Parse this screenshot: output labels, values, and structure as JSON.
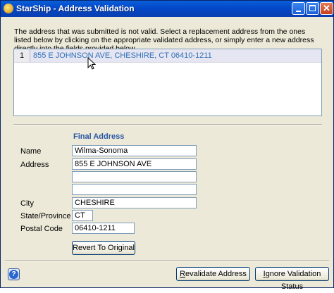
{
  "window": {
    "title": "StarShip - Address Validation",
    "close_glyph": "✕",
    "icons": {
      "app": "app-icon",
      "minimize": "minimize-icon",
      "maximize": "maximize-icon",
      "close": "close-icon"
    }
  },
  "instructions": "The address that was submitted is not valid.  Select a replacement address from the ones listed below by clicking on the appropriate validated address, or simply enter a new address directly into the fields provided below.",
  "suggestions": [
    {
      "index": "1",
      "address": "855 E JOHNSON AVE, CHESHIRE, CT 06410-1211"
    }
  ],
  "final_address": {
    "title": "Final Address",
    "name_label": "Name",
    "name": "Wilma-Sonoma",
    "address_label": "Address",
    "address1": "855 E JOHNSON AVE",
    "address2": "",
    "address3": "",
    "city_label": "City",
    "city": "CHESHIRE",
    "state_label": "State/Province",
    "state": "CT",
    "postal_label": "Postal Code",
    "postal": "06410-1211",
    "revert_button": "Revert To Original"
  },
  "footer": {
    "help_glyph": "?",
    "revalidate_first": "R",
    "revalidate_rest": "evalidate Address",
    "ignore_first": "I",
    "ignore_rest": "gnore Validation Status"
  },
  "colors": {
    "titlebar": "#0347c8",
    "accent_text": "#2a55a4",
    "selected_row_text": "#2f6fb8"
  }
}
